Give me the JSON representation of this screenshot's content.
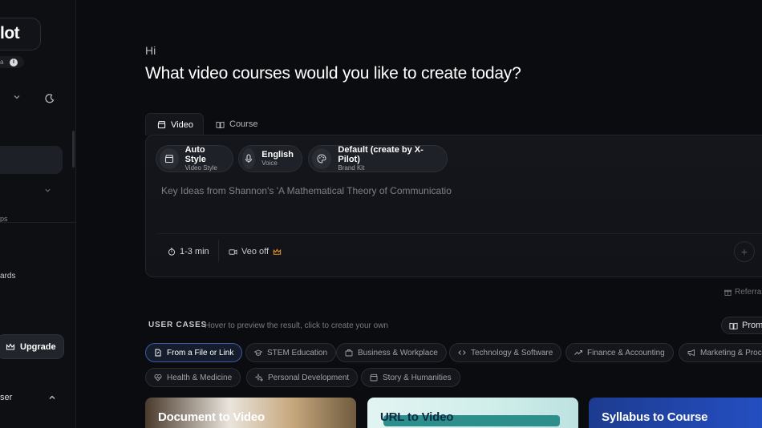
{
  "sidebar": {
    "logo": "lot",
    "badge_text": "a",
    "info": "i",
    "section_abbrev": "ps",
    "item_cards": "ards",
    "upgrade_label": "Upgrade",
    "user_label": "ser"
  },
  "main": {
    "greeting": "Hi",
    "headline": "What video courses would you like to create today?"
  },
  "tabs": [
    {
      "label": "Video",
      "icon": "clapperboard-icon",
      "active": true
    },
    {
      "label": "Course",
      "icon": "book-icon",
      "active": false
    }
  ],
  "options": {
    "style": {
      "title": "Auto Style",
      "subtitle": "Video Style"
    },
    "language": {
      "title": "English",
      "subtitle": "Voice"
    },
    "brand": {
      "title": "Default (create by X-Pilot)",
      "subtitle": "Brand Kit"
    }
  },
  "prompt": {
    "value": "Key Ideas from Shannon's 'A Mathematical Theory of Communicatio"
  },
  "toolbar": {
    "duration": "1-3 min",
    "veo": "Veo off",
    "plus": "+"
  },
  "referral": "Referra",
  "use_cases": {
    "title": "USER CASES",
    "hint": "Hover to preview the result, click to create your own",
    "prompt_button": "Promp"
  },
  "categories": [
    {
      "label": "From a File or Link",
      "icon": "file-link-icon",
      "active": true
    },
    {
      "label": "STEM Education",
      "icon": "graduation-cap-icon"
    },
    {
      "label": "Business & Workplace",
      "icon": "briefcase-icon"
    },
    {
      "label": "Technology & Software",
      "icon": "code-icon"
    },
    {
      "label": "Finance & Accounting",
      "icon": "trending-up-icon"
    },
    {
      "label": "Marketing & Proc",
      "icon": "megaphone-icon"
    },
    {
      "label": "Health & Medicine",
      "icon": "heart-pulse-icon"
    },
    {
      "label": "Personal Development",
      "icon": "sparkles-icon"
    },
    {
      "label": "Story & Humanities",
      "icon": "film-icon"
    }
  ],
  "cards": [
    {
      "title": "Document to Video"
    },
    {
      "title": "URL to Video"
    },
    {
      "title": "Syllabus to Course"
    }
  ],
  "colors": {
    "background": "#0b0c10",
    "panel": "#14161c",
    "accent_border": "#3c5ba3",
    "crown": "#e0902b"
  }
}
